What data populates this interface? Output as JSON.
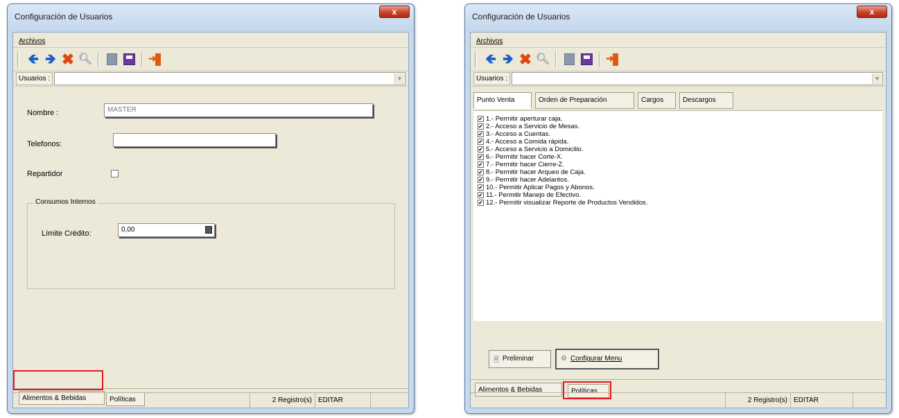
{
  "left_window": {
    "title": "Configuración de Usuarios",
    "close_label": "x",
    "menu_archivos": "Archivos",
    "users_label": "Usuarios :",
    "users_value": "",
    "form": {
      "nombre_label": "Nombre :",
      "nombre_value": "MASTER",
      "telefonos_label": "Telefonos:",
      "telefonos_value": "",
      "repartidor_label": "Repartidor",
      "repartidor_checked": false,
      "group_title": "Consumos Internos",
      "limite_label": "Límite Crédito:",
      "limite_value": "0,00"
    },
    "bottom_tabs": [
      "Alimentos & Bebidas",
      "Políticas"
    ],
    "active_bottom_tab": "Alimentos & Bebidas",
    "status": {
      "records": "2 Registro(s)",
      "mode": "EDITAR"
    }
  },
  "right_window": {
    "title": "Configuración de Usuarios",
    "close_label": "x",
    "menu_archivos": "Archivos",
    "users_label": "Usuarios :",
    "users_value": "",
    "inner_tabs": [
      "Punto Venta",
      "Orden de Preparación",
      "Cargos",
      "Descargos"
    ],
    "active_inner_tab": "Punto Venta",
    "permissions": [
      "1.-   Permitir aperturar caja.",
      "2.-   Acceso a Servicio de Mesas.",
      "3.-   Acceso a Cuentas.",
      "4.-   Acceso a Comida rápida.",
      "5.-   Acceso a Servicio a Domicilio.",
      "6.-   Permitir hacer Corte-X.",
      "7.-   Permitir hacer Cierre-Z.",
      "8.-   Permitir hacer Arqueo de Caja.",
      "9.-   Permitir hacer Adelantos.",
      "10.- Permitir Aplicar Pagos y Abonos.",
      "11.- Permitir Manejo de Efectivo.",
      "12.- Permitir visualizar Reporte de Productos Vendidos."
    ],
    "buttons": {
      "preliminar": "Preliminar",
      "configurar_menu": "Configurar Menu"
    },
    "bottom_tabs": [
      "Alimentos & Bebidas",
      "Políticas"
    ],
    "active_bottom_tab": "Políticas",
    "status": {
      "records": "2 Registro(s)",
      "mode": "EDITAR"
    }
  },
  "icons": [
    "back-arrow-icon",
    "forward-arrow-icon",
    "delete-icon",
    "search-icon",
    "document-icon",
    "save-icon",
    "exit-icon",
    "calculator-icon",
    "print-preview-icon",
    "gear-icon"
  ],
  "colors": {
    "highlight": "#e8161e",
    "titlebar": "#c8d9ec",
    "toolbar_arrow": "#1e5fc8",
    "delete_x": "#e04810"
  }
}
